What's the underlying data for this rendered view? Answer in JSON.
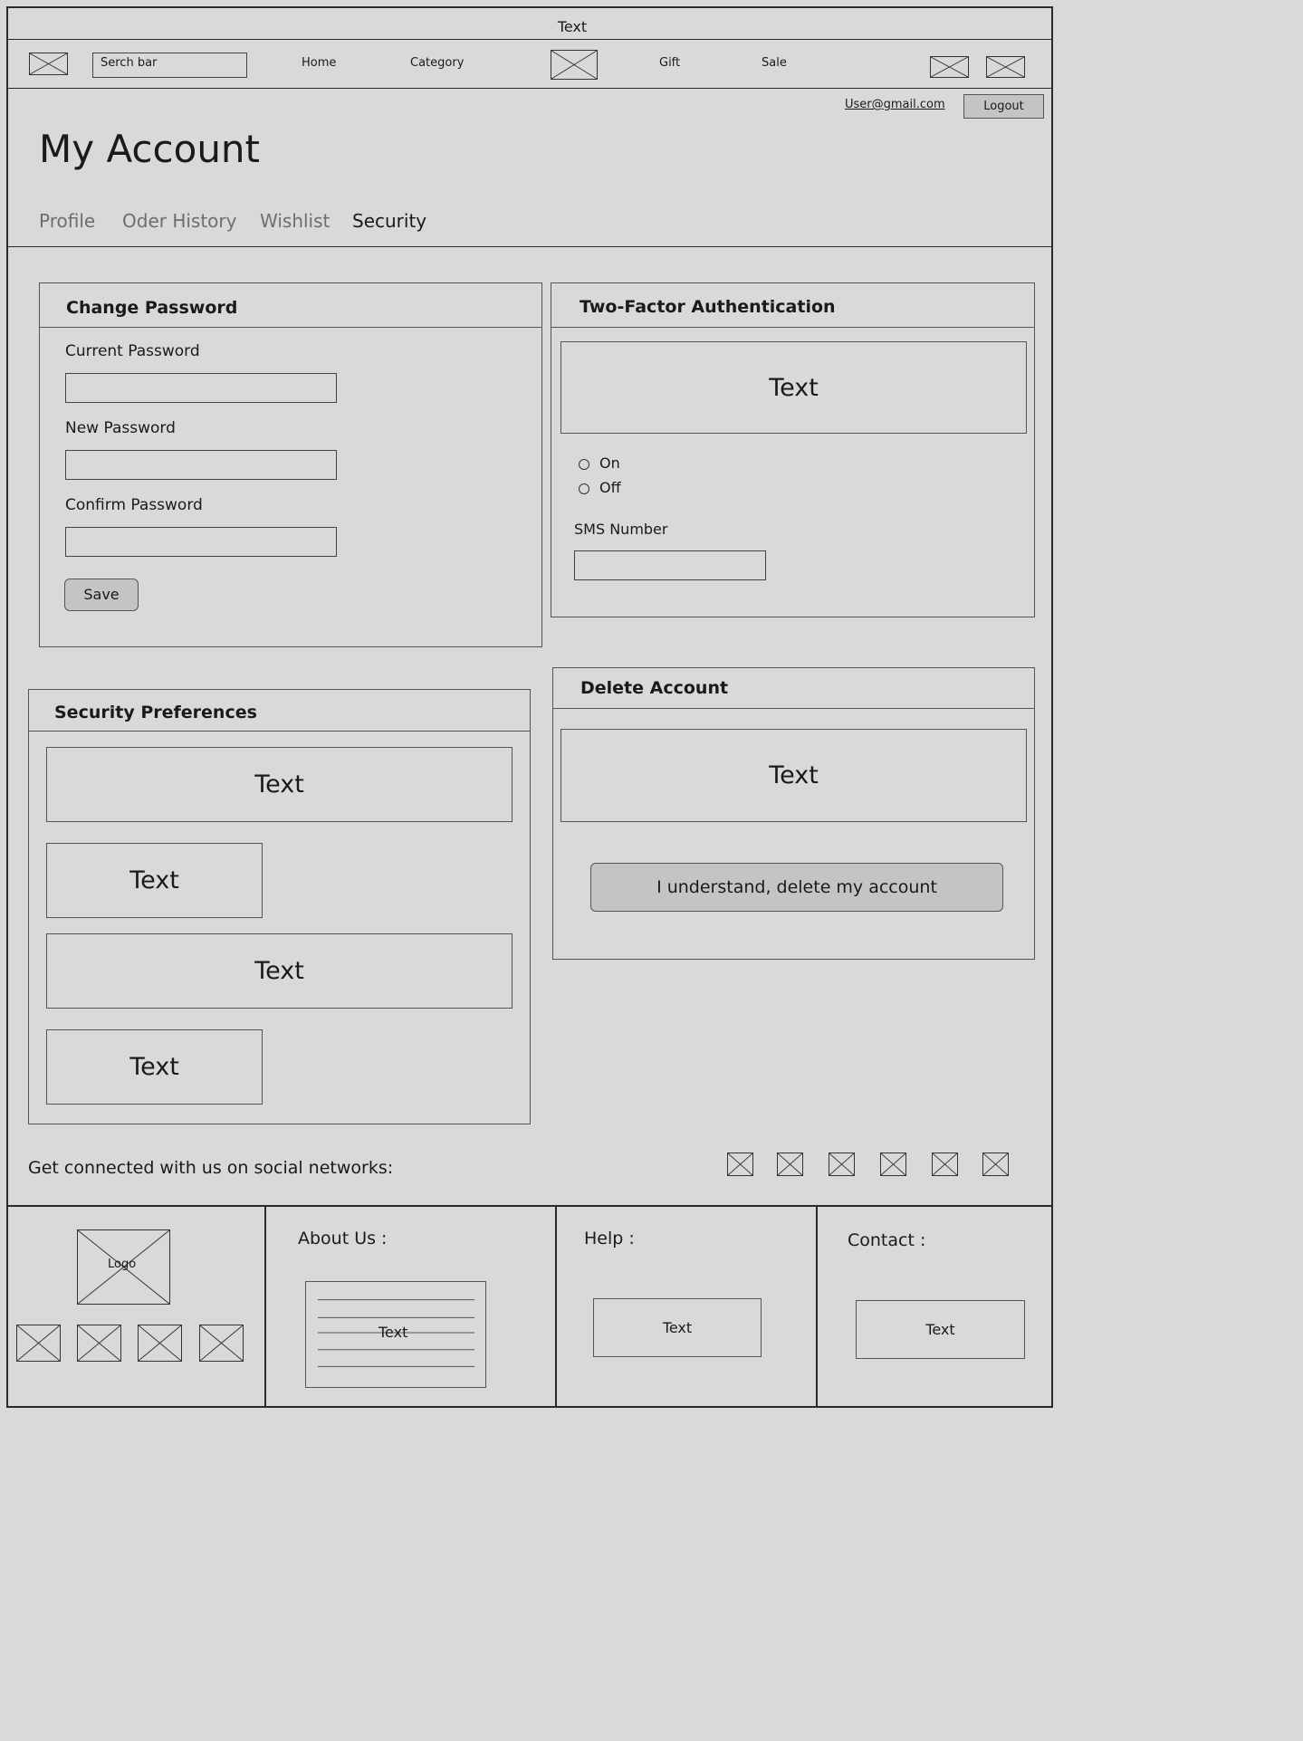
{
  "top_banner": "Text",
  "header": {
    "search_placeholder": "Serch bar",
    "nav": [
      "Home",
      "Category",
      "Gift",
      "Sale"
    ]
  },
  "account": {
    "user_email": "User@gmail.com",
    "logout_label": "Logout",
    "page_title": "My Account",
    "tabs": [
      {
        "label": "Profile",
        "active": false
      },
      {
        "label": "Oder History",
        "active": false
      },
      {
        "label": "Wishlist",
        "active": false
      },
      {
        "label": "Security",
        "active": true
      }
    ]
  },
  "change_password": {
    "title": "Change Password",
    "current_label": "Current Password",
    "new_label": "New Password",
    "confirm_label": "Confirm Password",
    "save_label": "Save"
  },
  "two_factor": {
    "title": "Two-Factor Authentication",
    "text": "Text",
    "option_on": "On",
    "option_off": "Off",
    "sms_label": "SMS Number"
  },
  "security_preferences": {
    "title": "Security Preferences",
    "items": [
      "Text",
      "Text",
      "Text",
      "Text"
    ]
  },
  "delete_account": {
    "title": "Delete Account",
    "text": "Text",
    "button_label": "I understand, delete my account"
  },
  "social": {
    "label": "Get connected with us on social networks:",
    "icons": [
      "social-icon-1",
      "social-icon-2",
      "social-icon-3",
      "social-icon-4",
      "social-icon-5",
      "social-icon-6"
    ]
  },
  "footer": {
    "logo_label": "Logo",
    "about_title": "About Us :",
    "about_text": "Text",
    "help_title": "Help :",
    "help_text": "Text",
    "contact_title": "Contact :",
    "contact_text": "Text"
  }
}
